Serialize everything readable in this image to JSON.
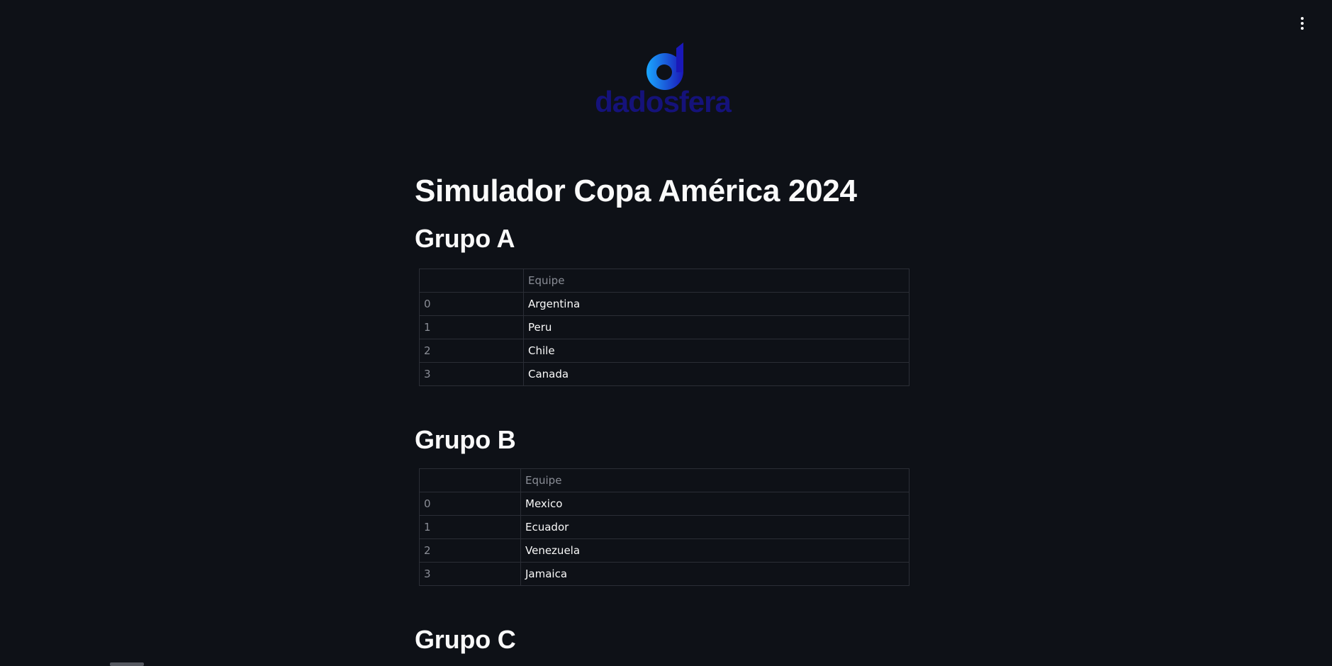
{
  "app": {
    "logo_text": "dadosfera",
    "title": "Simulador Copa América 2024"
  },
  "colors": {
    "background": "#0e1117",
    "text": "#fafafa",
    "muted": "#8a8d96",
    "border": "#2b2e36",
    "logo_blue_light": "#1aa7ff",
    "logo_blue_dark": "#1a18b8",
    "logo_text": "#15127a"
  },
  "icons": {
    "menu": "vertical-ellipsis-icon"
  },
  "groups": [
    {
      "title": "Grupo A",
      "column": "Equipe",
      "rows": [
        {
          "index": "0",
          "team": "Argentina"
        },
        {
          "index": "1",
          "team": "Peru"
        },
        {
          "index": "2",
          "team": "Chile"
        },
        {
          "index": "3",
          "team": "Canada"
        }
      ]
    },
    {
      "title": "Grupo B",
      "column": "Equipe",
      "rows": [
        {
          "index": "0",
          "team": "Mexico"
        },
        {
          "index": "1",
          "team": "Ecuador"
        },
        {
          "index": "2",
          "team": "Venezuela"
        },
        {
          "index": "3",
          "team": "Jamaica"
        }
      ]
    },
    {
      "title": "Grupo C"
    }
  ]
}
